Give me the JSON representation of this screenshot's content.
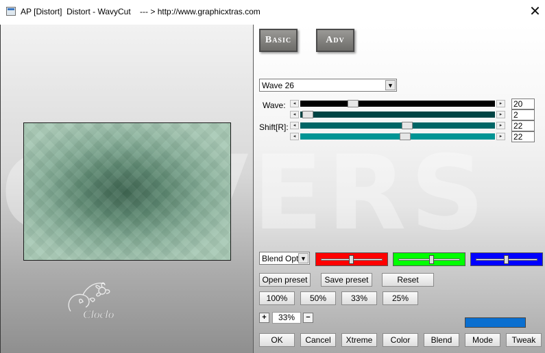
{
  "window": {
    "title": "AP [Distort]  Distort - WavyCut    --- > http://www.graphicxtras.com",
    "close_glyph": "✕"
  },
  "watermark_text": "COVERS",
  "logo_text": "Cloclo",
  "tabs": {
    "basic": "Basic",
    "adv": "Adv"
  },
  "preset_select": {
    "value": "Wave 26"
  },
  "params": {
    "label_wave": "Wave:",
    "label_shift": "Shift[R]:",
    "sliders": [
      {
        "value": "20",
        "position": 0.27,
        "track_color": "#000000"
      },
      {
        "value": "2",
        "position": 0.04,
        "track_color": "#004444"
      },
      {
        "value": "22",
        "position": 0.55,
        "track_color": "#006666"
      },
      {
        "value": "22",
        "position": 0.54,
        "track_color": "#009494"
      }
    ]
  },
  "blend_select": {
    "value": "Blend Optio"
  },
  "color_sliders": [
    {
      "name": "red",
      "color": "#ff0000",
      "position": 0.48
    },
    {
      "name": "green",
      "color": "#00ff00",
      "position": 0.52
    },
    {
      "name": "blue",
      "color": "#0000ff",
      "position": 0.48
    }
  ],
  "buttons": {
    "open_preset": "Open preset",
    "save_preset": "Save preset",
    "reset": "Reset",
    "zoom_100": "100%",
    "zoom_50": "50%",
    "zoom_33": "33%",
    "zoom_25": "25%",
    "ok": "OK",
    "cancel": "Cancel",
    "xtreme": "Xtreme",
    "color": "Color",
    "blend": "Blend",
    "mode": "Mode",
    "tweak": "Tweak"
  },
  "zoom": {
    "plus": "+",
    "minus": "−",
    "value": "33%"
  },
  "swatch_color": "#0a6fd0",
  "icons": {
    "app": "window-icon",
    "close": "close-icon",
    "dropdown": "▼",
    "arrow_left": "◂",
    "arrow_right": "▸"
  }
}
